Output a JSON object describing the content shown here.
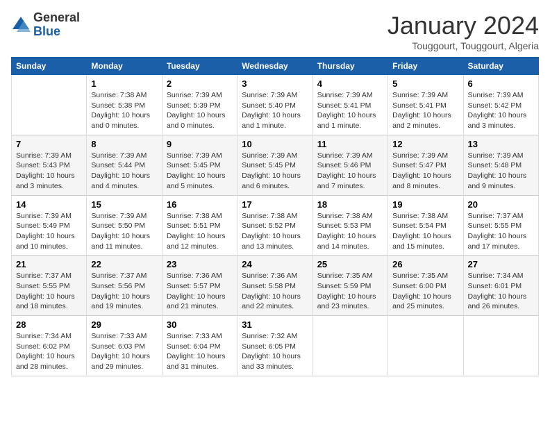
{
  "logo": {
    "general": "General",
    "blue": "Blue"
  },
  "header": {
    "month": "January 2024",
    "location": "Touggourt, Touggourt, Algeria"
  },
  "days_of_week": [
    "Sunday",
    "Monday",
    "Tuesday",
    "Wednesday",
    "Thursday",
    "Friday",
    "Saturday"
  ],
  "weeks": [
    [
      {
        "day": "",
        "info": ""
      },
      {
        "day": "1",
        "info": "Sunrise: 7:38 AM\nSunset: 5:38 PM\nDaylight: 10 hours\nand 0 minutes."
      },
      {
        "day": "2",
        "info": "Sunrise: 7:39 AM\nSunset: 5:39 PM\nDaylight: 10 hours\nand 0 minutes."
      },
      {
        "day": "3",
        "info": "Sunrise: 7:39 AM\nSunset: 5:40 PM\nDaylight: 10 hours\nand 1 minute."
      },
      {
        "day": "4",
        "info": "Sunrise: 7:39 AM\nSunset: 5:41 PM\nDaylight: 10 hours\nand 1 minute."
      },
      {
        "day": "5",
        "info": "Sunrise: 7:39 AM\nSunset: 5:41 PM\nDaylight: 10 hours\nand 2 minutes."
      },
      {
        "day": "6",
        "info": "Sunrise: 7:39 AM\nSunset: 5:42 PM\nDaylight: 10 hours\nand 3 minutes."
      }
    ],
    [
      {
        "day": "7",
        "info": "Sunrise: 7:39 AM\nSunset: 5:43 PM\nDaylight: 10 hours\nand 3 minutes."
      },
      {
        "day": "8",
        "info": "Sunrise: 7:39 AM\nSunset: 5:44 PM\nDaylight: 10 hours\nand 4 minutes."
      },
      {
        "day": "9",
        "info": "Sunrise: 7:39 AM\nSunset: 5:45 PM\nDaylight: 10 hours\nand 5 minutes."
      },
      {
        "day": "10",
        "info": "Sunrise: 7:39 AM\nSunset: 5:45 PM\nDaylight: 10 hours\nand 6 minutes."
      },
      {
        "day": "11",
        "info": "Sunrise: 7:39 AM\nSunset: 5:46 PM\nDaylight: 10 hours\nand 7 minutes."
      },
      {
        "day": "12",
        "info": "Sunrise: 7:39 AM\nSunset: 5:47 PM\nDaylight: 10 hours\nand 8 minutes."
      },
      {
        "day": "13",
        "info": "Sunrise: 7:39 AM\nSunset: 5:48 PM\nDaylight: 10 hours\nand 9 minutes."
      }
    ],
    [
      {
        "day": "14",
        "info": "Sunrise: 7:39 AM\nSunset: 5:49 PM\nDaylight: 10 hours\nand 10 minutes."
      },
      {
        "day": "15",
        "info": "Sunrise: 7:39 AM\nSunset: 5:50 PM\nDaylight: 10 hours\nand 11 minutes."
      },
      {
        "day": "16",
        "info": "Sunrise: 7:38 AM\nSunset: 5:51 PM\nDaylight: 10 hours\nand 12 minutes."
      },
      {
        "day": "17",
        "info": "Sunrise: 7:38 AM\nSunset: 5:52 PM\nDaylight: 10 hours\nand 13 minutes."
      },
      {
        "day": "18",
        "info": "Sunrise: 7:38 AM\nSunset: 5:53 PM\nDaylight: 10 hours\nand 14 minutes."
      },
      {
        "day": "19",
        "info": "Sunrise: 7:38 AM\nSunset: 5:54 PM\nDaylight: 10 hours\nand 15 minutes."
      },
      {
        "day": "20",
        "info": "Sunrise: 7:37 AM\nSunset: 5:55 PM\nDaylight: 10 hours\nand 17 minutes."
      }
    ],
    [
      {
        "day": "21",
        "info": "Sunrise: 7:37 AM\nSunset: 5:55 PM\nDaylight: 10 hours\nand 18 minutes."
      },
      {
        "day": "22",
        "info": "Sunrise: 7:37 AM\nSunset: 5:56 PM\nDaylight: 10 hours\nand 19 minutes."
      },
      {
        "day": "23",
        "info": "Sunrise: 7:36 AM\nSunset: 5:57 PM\nDaylight: 10 hours\nand 21 minutes."
      },
      {
        "day": "24",
        "info": "Sunrise: 7:36 AM\nSunset: 5:58 PM\nDaylight: 10 hours\nand 22 minutes."
      },
      {
        "day": "25",
        "info": "Sunrise: 7:35 AM\nSunset: 5:59 PM\nDaylight: 10 hours\nand 23 minutes."
      },
      {
        "day": "26",
        "info": "Sunrise: 7:35 AM\nSunset: 6:00 PM\nDaylight: 10 hours\nand 25 minutes."
      },
      {
        "day": "27",
        "info": "Sunrise: 7:34 AM\nSunset: 6:01 PM\nDaylight: 10 hours\nand 26 minutes."
      }
    ],
    [
      {
        "day": "28",
        "info": "Sunrise: 7:34 AM\nSunset: 6:02 PM\nDaylight: 10 hours\nand 28 minutes."
      },
      {
        "day": "29",
        "info": "Sunrise: 7:33 AM\nSunset: 6:03 PM\nDaylight: 10 hours\nand 29 minutes."
      },
      {
        "day": "30",
        "info": "Sunrise: 7:33 AM\nSunset: 6:04 PM\nDaylight: 10 hours\nand 31 minutes."
      },
      {
        "day": "31",
        "info": "Sunrise: 7:32 AM\nSunset: 6:05 PM\nDaylight: 10 hours\nand 33 minutes."
      },
      {
        "day": "",
        "info": ""
      },
      {
        "day": "",
        "info": ""
      },
      {
        "day": "",
        "info": ""
      }
    ]
  ]
}
